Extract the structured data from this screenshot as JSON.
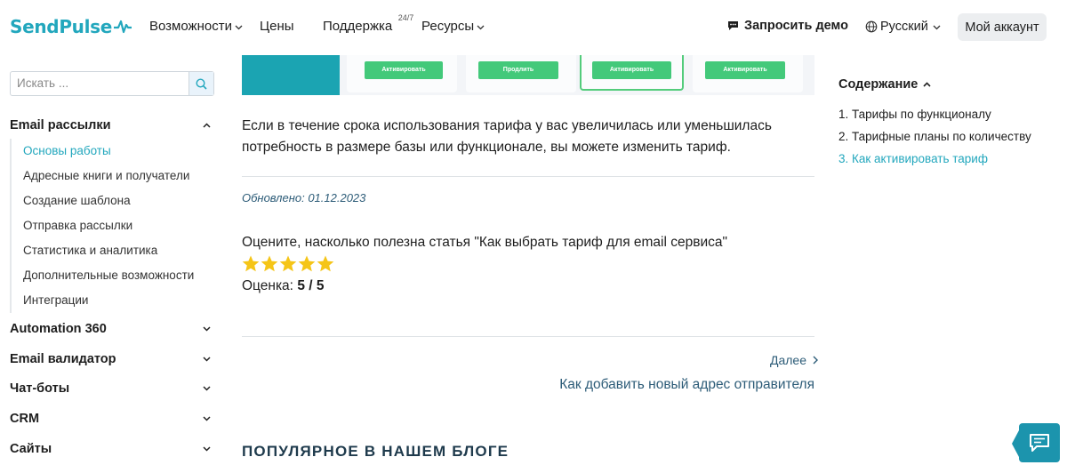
{
  "header": {
    "logo": "SendPulse",
    "nav": {
      "features": "Возможности",
      "pricing": "Цены",
      "support": "Поддержка",
      "support_badge": "24/7",
      "resources": "Ресурсы"
    },
    "demo": "Запросить демо",
    "language": "Русский",
    "account": "Мой аккаунт"
  },
  "sidebar": {
    "search_placeholder": "Искать ...",
    "sections": [
      {
        "label": "Email рассылки",
        "expanded": true
      },
      {
        "label": "Automation 360",
        "expanded": false
      },
      {
        "label": "Email валидатор",
        "expanded": false
      },
      {
        "label": "Чат-боты",
        "expanded": false
      },
      {
        "label": "CRM",
        "expanded": false
      },
      {
        "label": "Сайты",
        "expanded": false
      }
    ],
    "email_items": [
      {
        "label": "Основы работы",
        "active": true
      },
      {
        "label": "Адресные книги и получатели",
        "active": false
      },
      {
        "label": "Создание шаблона",
        "active": false
      },
      {
        "label": "Отправка рассылки",
        "active": false
      },
      {
        "label": "Статистика и аналитика",
        "active": false
      },
      {
        "label": "Дополнительные возможности",
        "active": false
      },
      {
        "label": "Интеграции",
        "active": false
      }
    ]
  },
  "main": {
    "hero_buttons": [
      "Активировать",
      "Продлить",
      "Активировать",
      "Активировать"
    ],
    "paragraph": "Если в течение срока использования тарифа у вас увеличилась или уменьшилась потребность в размере базы или функционале, вы можете изменить тариф.",
    "updated": "Обновлено: 01.12.2023",
    "rating_question": "Оцените, насколько полезна статья \"Как выбрать тариф для email сервиса\"",
    "rating": {
      "label": "Оценка:",
      "value": "5 / 5",
      "stars": 5,
      "max": 5
    },
    "next": {
      "label": "Далее",
      "title": "Как добавить новый адрес отправителя"
    },
    "blog_heading": "ПОПУЛЯРНОЕ В НАШЕМ БЛОГЕ"
  },
  "toc": {
    "title": "Содержание",
    "items": [
      {
        "label": "1. Тарифы по функционалу",
        "active": false
      },
      {
        "label": "2. Тарифные планы по количеству",
        "active": false
      },
      {
        "label": "3. Как активировать тариф",
        "active": true
      }
    ]
  },
  "colors": {
    "brand": "#22a7bd",
    "link": "#2d5c78",
    "star": "#f5c518",
    "chat": "#1c94ad"
  }
}
